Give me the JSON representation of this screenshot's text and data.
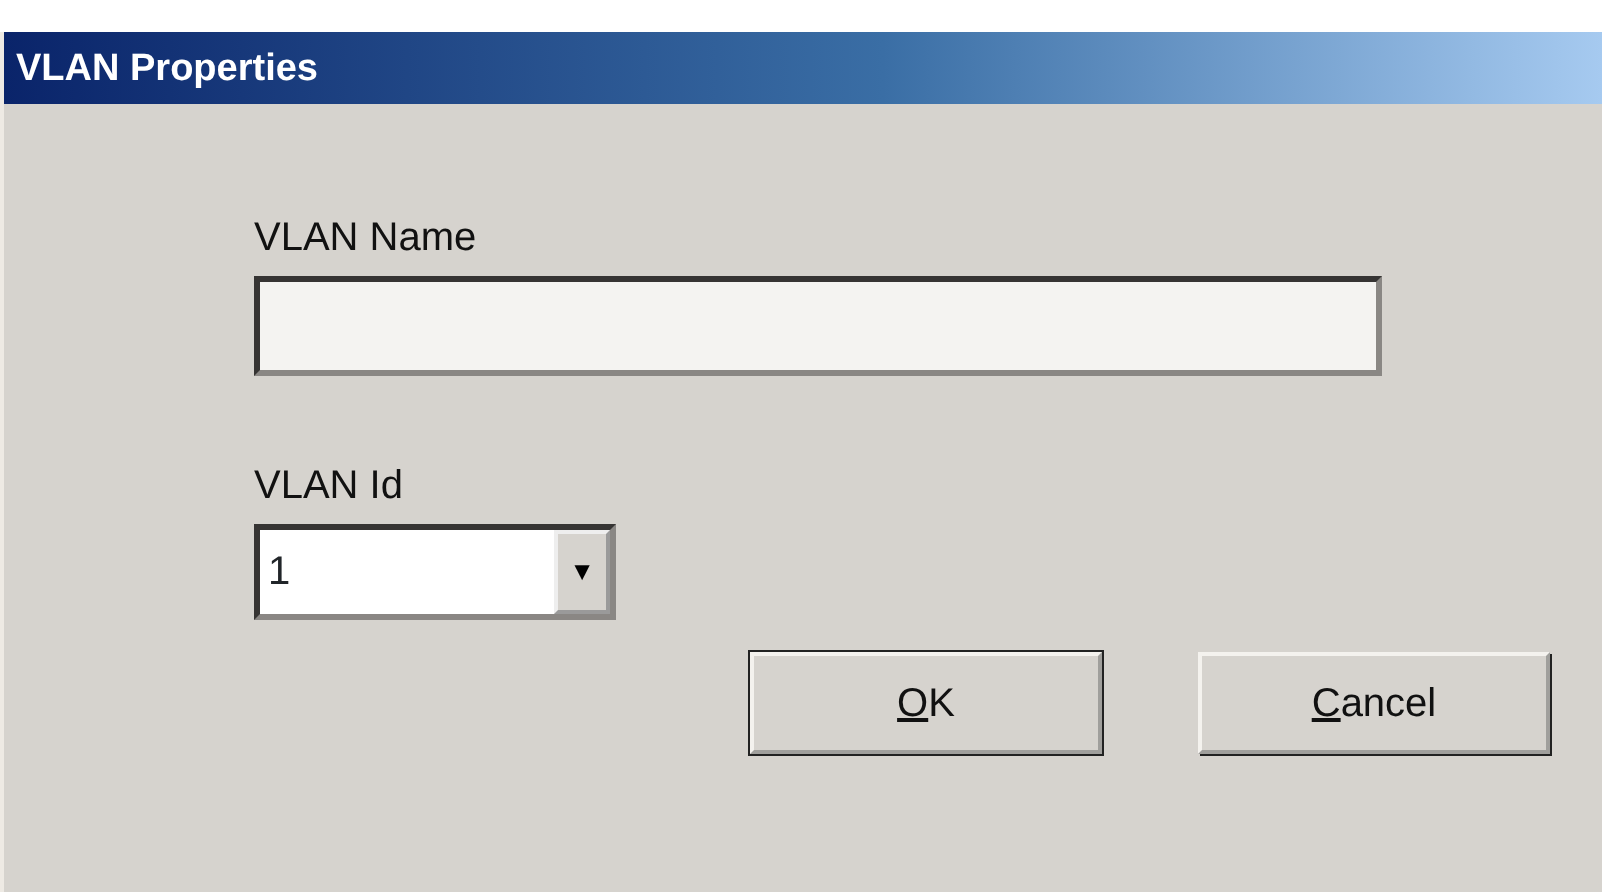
{
  "window": {
    "title": "VLAN Properties"
  },
  "fields": [
    {
      "kind": "text",
      "label": "VLAN Name"
    },
    {
      "kind": "dropdown",
      "label": "VLAN Id",
      "value": "1",
      "arrow": "▼"
    }
  ],
  "buttons": [
    {
      "access_key": "O",
      "label_rest": "K"
    },
    {
      "access_key": "C",
      "label_rest": "ancel"
    }
  ]
}
